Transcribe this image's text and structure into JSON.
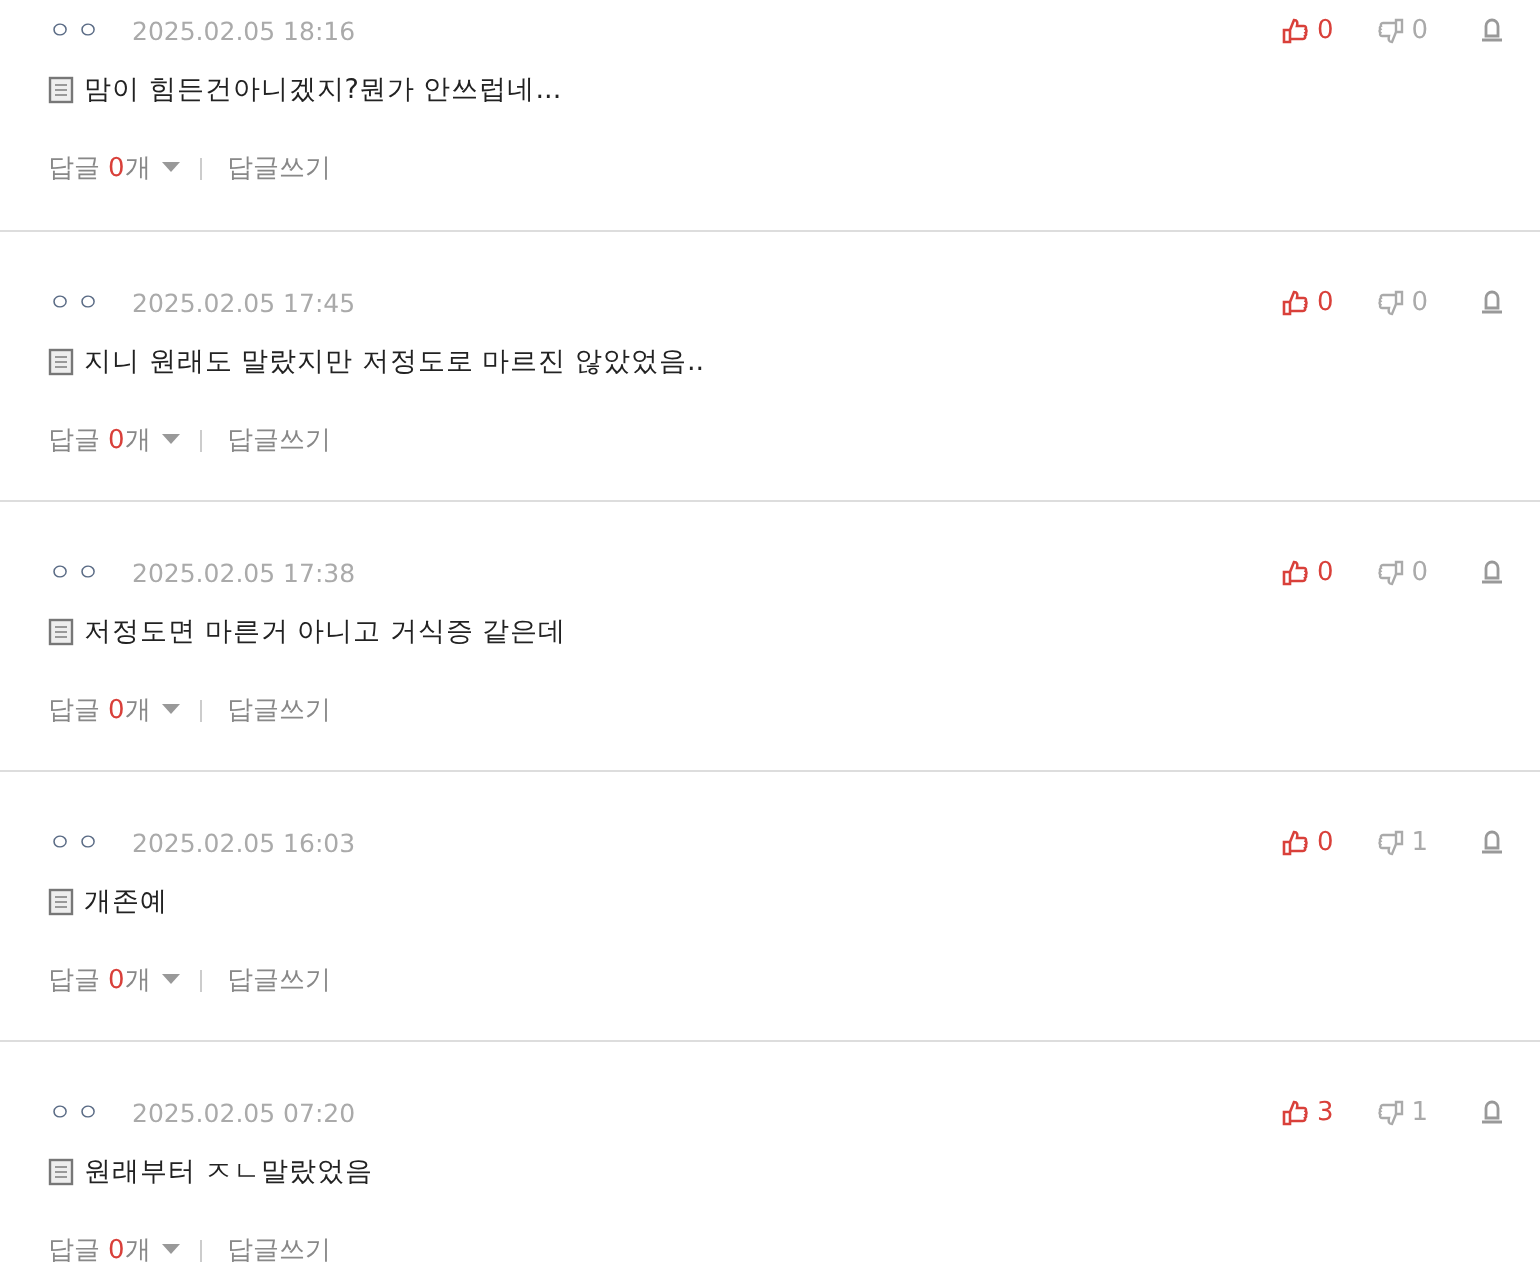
{
  "comments": [
    {
      "author": "ㅇㅇ",
      "date": "2025.02.05 18:16",
      "text": "맘이 힘든건아니겠지?뭔가 안쓰럽네...",
      "likes": "0",
      "dislikes": "0",
      "reply_label": "답글",
      "reply_count": "0",
      "reply_unit": "개",
      "write_reply": "답글쓰기"
    },
    {
      "author": "ㅇㅇ",
      "date": "2025.02.05 17:45",
      "text": "지니 원래도 말랐지만 저정도로 마르진 않았었음..",
      "likes": "0",
      "dislikes": "0",
      "reply_label": "답글",
      "reply_count": "0",
      "reply_unit": "개",
      "write_reply": "답글쓰기"
    },
    {
      "author": "ㅇㅇ",
      "date": "2025.02.05 17:38",
      "text": "저정도면 마른거 아니고 거식증 같은데",
      "likes": "0",
      "dislikes": "0",
      "reply_label": "답글",
      "reply_count": "0",
      "reply_unit": "개",
      "write_reply": "답글쓰기"
    },
    {
      "author": "ㅇㅇ",
      "date": "2025.02.05 16:03",
      "text": "개존예",
      "likes": "0",
      "dislikes": "1",
      "reply_label": "답글",
      "reply_count": "0",
      "reply_unit": "개",
      "write_reply": "답글쓰기"
    },
    {
      "author": "ㅇㅇ",
      "date": "2025.02.05 07:20",
      "text": "원래부터 ㅈㄴ말랐었음",
      "likes": "3",
      "dislikes": "1",
      "reply_label": "답글",
      "reply_count": "0",
      "reply_unit": "개",
      "write_reply": "답글쓰기"
    }
  ]
}
